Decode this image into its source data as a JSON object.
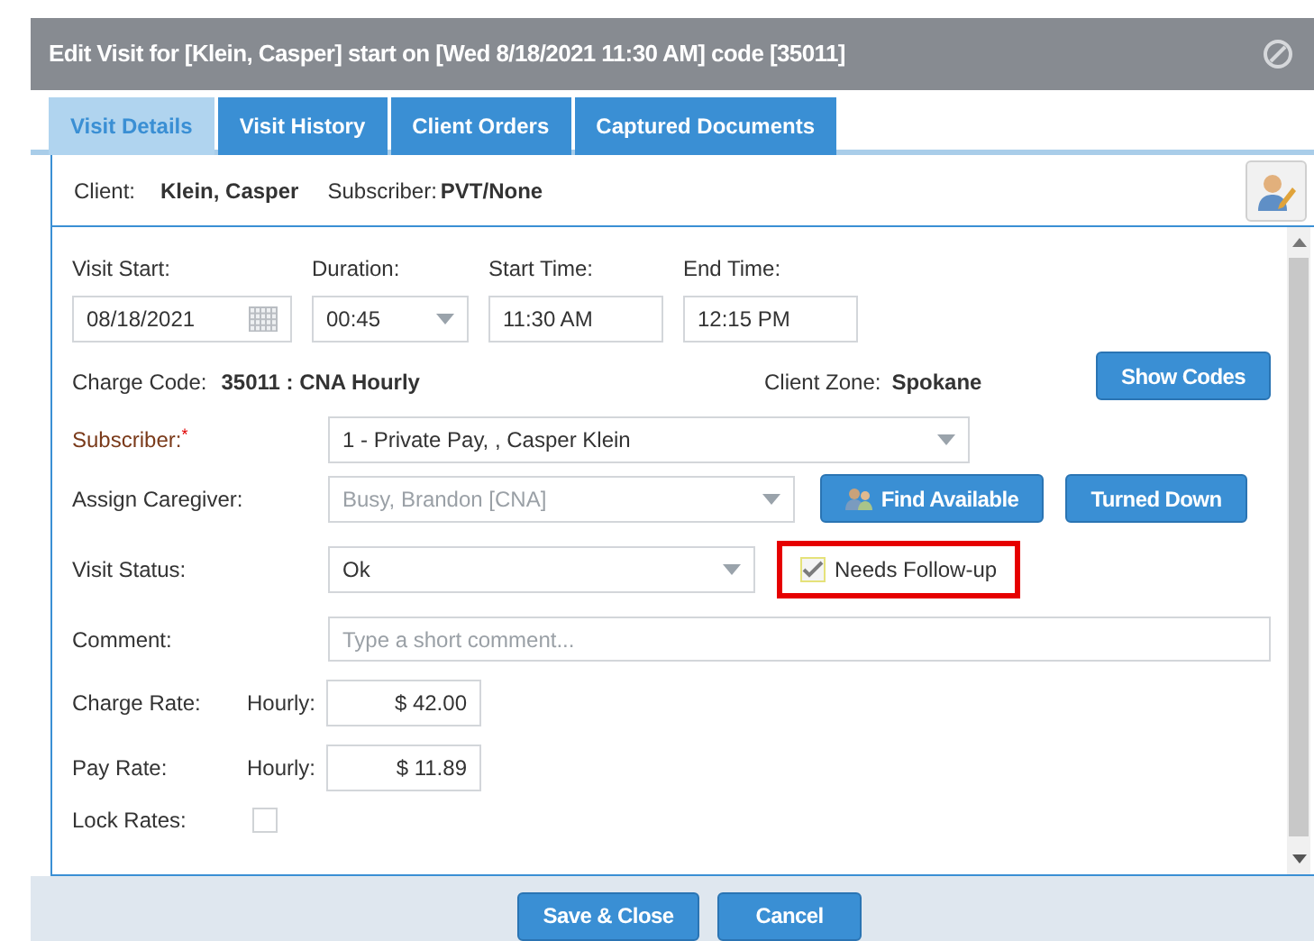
{
  "window": {
    "title": "Edit Visit for [Klein, Casper] start on [Wed 8/18/2021 11:30 AM] code [35011]"
  },
  "tabs": [
    {
      "label": "Visit Details",
      "selected": true
    },
    {
      "label": "Visit History",
      "selected": false
    },
    {
      "label": "Client Orders",
      "selected": false
    },
    {
      "label": "Captured Documents",
      "selected": false
    }
  ],
  "client_bar": {
    "client_label": "Client:",
    "client": "Klein, Casper",
    "subscriber_label": "Subscriber:",
    "subscriber": "PVT/None"
  },
  "schedule": [
    {
      "label": "Visit Start:",
      "value": "08/18/2021",
      "kind": "date"
    },
    {
      "label": "Duration:",
      "value": "00:45",
      "kind": "select"
    },
    {
      "label": "Start Time:",
      "value": "11:30 AM",
      "kind": "text"
    },
    {
      "label": "End Time:",
      "value": "12:15 PM",
      "kind": "text"
    }
  ],
  "charge_code": {
    "label": "Charge Code:",
    "value": "35011 : CNA Hourly",
    "zone_label": "Client Zone:",
    "zone": "Spokane",
    "button": "Show Codes"
  },
  "subscriber": {
    "label": "Subscriber:",
    "required_mark": "*",
    "value": "1 - Private Pay, , Casper Klein"
  },
  "caregiver": {
    "label": "Assign Caregiver:",
    "value": "Busy, Brandon [CNA]",
    "disabled": true,
    "buttons": [
      "Find Available",
      "Turned Down"
    ]
  },
  "visit_status": {
    "label": "Visit Status:",
    "value": "Ok",
    "follow_up": {
      "label": "Needs Follow-up",
      "checked": true,
      "highlighted": true
    }
  },
  "comment": {
    "label": "Comment:",
    "placeholder": "Type a short comment..."
  },
  "rates": [
    {
      "label": "Charge Rate:",
      "unit": "Hourly:",
      "value": "$ 42.00"
    },
    {
      "label": "Pay Rate:",
      "unit": "Hourly:",
      "value": "$ 11.89"
    }
  ],
  "lock_rates": {
    "label": "Lock Rates:",
    "checked": false
  },
  "footer_buttons": [
    {
      "label": "Save & Close"
    },
    {
      "label": "Cancel"
    }
  ]
}
